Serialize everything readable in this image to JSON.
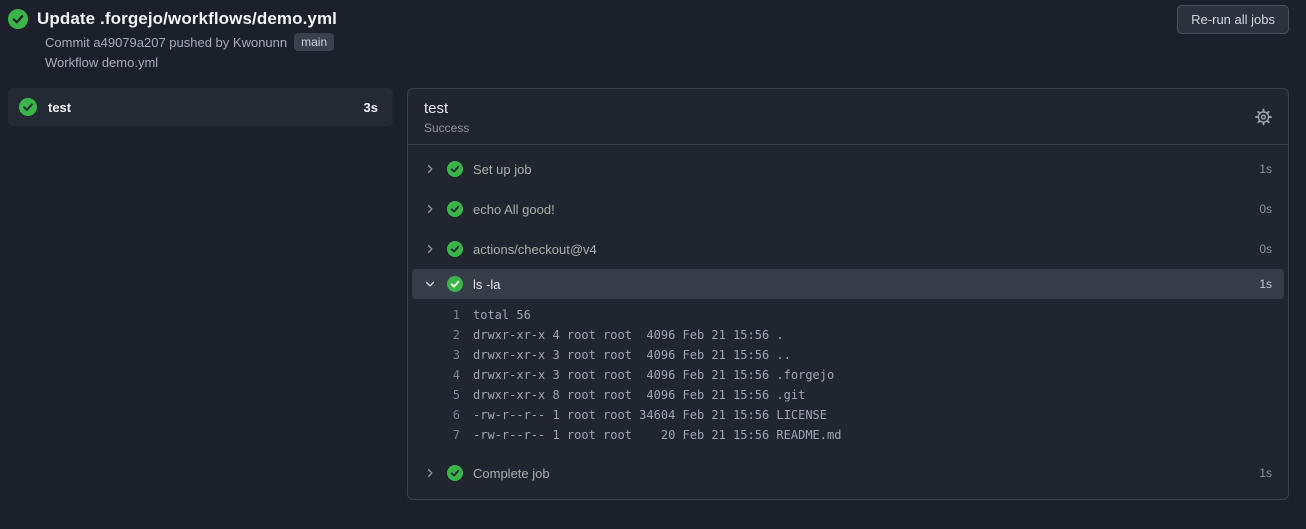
{
  "header": {
    "title": "Update .forgejo/workflows/demo.yml",
    "commit_text": "Commit a49079a207 pushed by Kwonunn",
    "branch": "main",
    "workflow_text": "Workflow demo.yml",
    "rerun_button": "Re-run all jobs"
  },
  "sidebar": {
    "jobs": [
      {
        "name": "test",
        "duration": "3s",
        "status": "success"
      }
    ]
  },
  "panel": {
    "job_name": "test",
    "job_status": "Success",
    "steps": [
      {
        "label": "Set up job",
        "duration": "1s",
        "status": "success",
        "expanded": false
      },
      {
        "label": "echo All good!",
        "duration": "0s",
        "status": "success",
        "expanded": false
      },
      {
        "label": "actions/checkout@v4",
        "duration": "0s",
        "status": "success",
        "expanded": false
      },
      {
        "label": "ls -la",
        "duration": "1s",
        "status": "success",
        "expanded": true
      },
      {
        "label": "Complete job",
        "duration": "1s",
        "status": "success",
        "expanded": false
      }
    ],
    "log": {
      "lines": [
        {
          "num": "1",
          "text": "total 56"
        },
        {
          "num": "2",
          "text": "drwxr-xr-x 4 root root  4096 Feb 21 15:56 ."
        },
        {
          "num": "3",
          "text": "drwxr-xr-x 3 root root  4096 Feb 21 15:56 .."
        },
        {
          "num": "4",
          "text": "drwxr-xr-x 3 root root  4096 Feb 21 15:56 .forgejo"
        },
        {
          "num": "5",
          "text": "drwxr-xr-x 8 root root  4096 Feb 21 15:56 .git"
        },
        {
          "num": "6",
          "text": "-rw-r--r-- 1 root root 34604 Feb 21 15:56 LICENSE"
        },
        {
          "num": "7",
          "text": "-rw-r--r-- 1 root root    20 Feb 21 15:56 README.md"
        }
      ]
    }
  },
  "icons": {
    "status": "check-circle-icon",
    "settings": "gear-icon",
    "collapsed": "chevron-right-icon",
    "expanded": "chevron-down-icon"
  },
  "colors": {
    "success_green": "#3ab54a",
    "page_background": "#1b202a",
    "panel_background": "#20252f",
    "highlight_row": "#363d49",
    "border": "#39404c"
  }
}
